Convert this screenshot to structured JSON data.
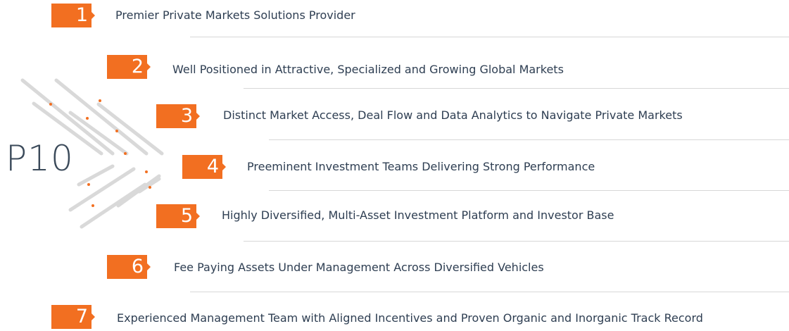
{
  "brand": {
    "logo_text": "P10",
    "accent_color": "#f26f21",
    "text_color": "#2e3e52"
  },
  "items": [
    {
      "number": "1",
      "label": "Premier Private Markets Solutions Provider"
    },
    {
      "number": "2",
      "label": "Well Positioned in Attractive, Specialized and Growing Global Markets"
    },
    {
      "number": "3",
      "label": "Distinct Market Access, Deal Flow and Data Analytics to Navigate Private Markets"
    },
    {
      "number": "4",
      "label": "Preeminent Investment Teams Delivering Strong Performance"
    },
    {
      "number": "5",
      "label": "Highly Diversified, Multi-Asset Investment Platform and Investor Base"
    },
    {
      "number": "6",
      "label": "Fee Paying Assets Under Management Across Diversified Vehicles"
    },
    {
      "number": "7",
      "label": "Experienced Management Team with Aligned Incentives and Proven Organic and Inorganic Track Record"
    }
  ]
}
